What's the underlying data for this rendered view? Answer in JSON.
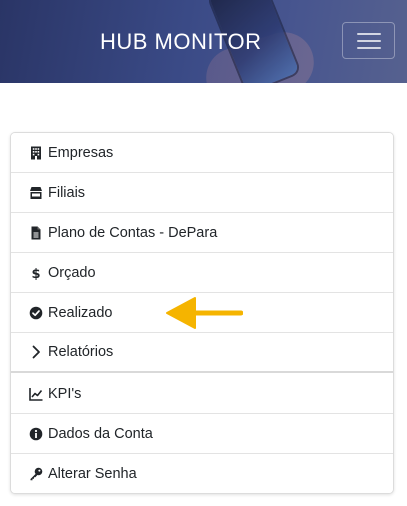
{
  "header": {
    "brand": "HUB MONITOR",
    "menu_toggle_icon": "hamburger-icon"
  },
  "menu": {
    "items": [
      {
        "label": "Empresas",
        "icon": "building-icon"
      },
      {
        "label": "Filiais",
        "icon": "store-icon"
      },
      {
        "label": "Plano de Contas - DePara",
        "icon": "file-icon"
      },
      {
        "label": "Orçado",
        "icon": "dollar-icon"
      },
      {
        "label": "Realizado",
        "icon": "check-circle-icon"
      },
      {
        "label": "Relatórios",
        "icon": "chevron-right-icon"
      },
      {
        "label": "KPI's",
        "icon": "line-chart-icon"
      },
      {
        "label": "Dados da Conta",
        "icon": "info-circle-icon"
      },
      {
        "label": "Alterar Senha",
        "icon": "key-icon"
      }
    ]
  },
  "annotation": {
    "arrow_icon": "left-arrow-icon",
    "arrow_color": "#f5b400"
  },
  "colors": {
    "header_bg": "#3a4a86",
    "text": "#212529",
    "border": "#dcdcdc"
  }
}
